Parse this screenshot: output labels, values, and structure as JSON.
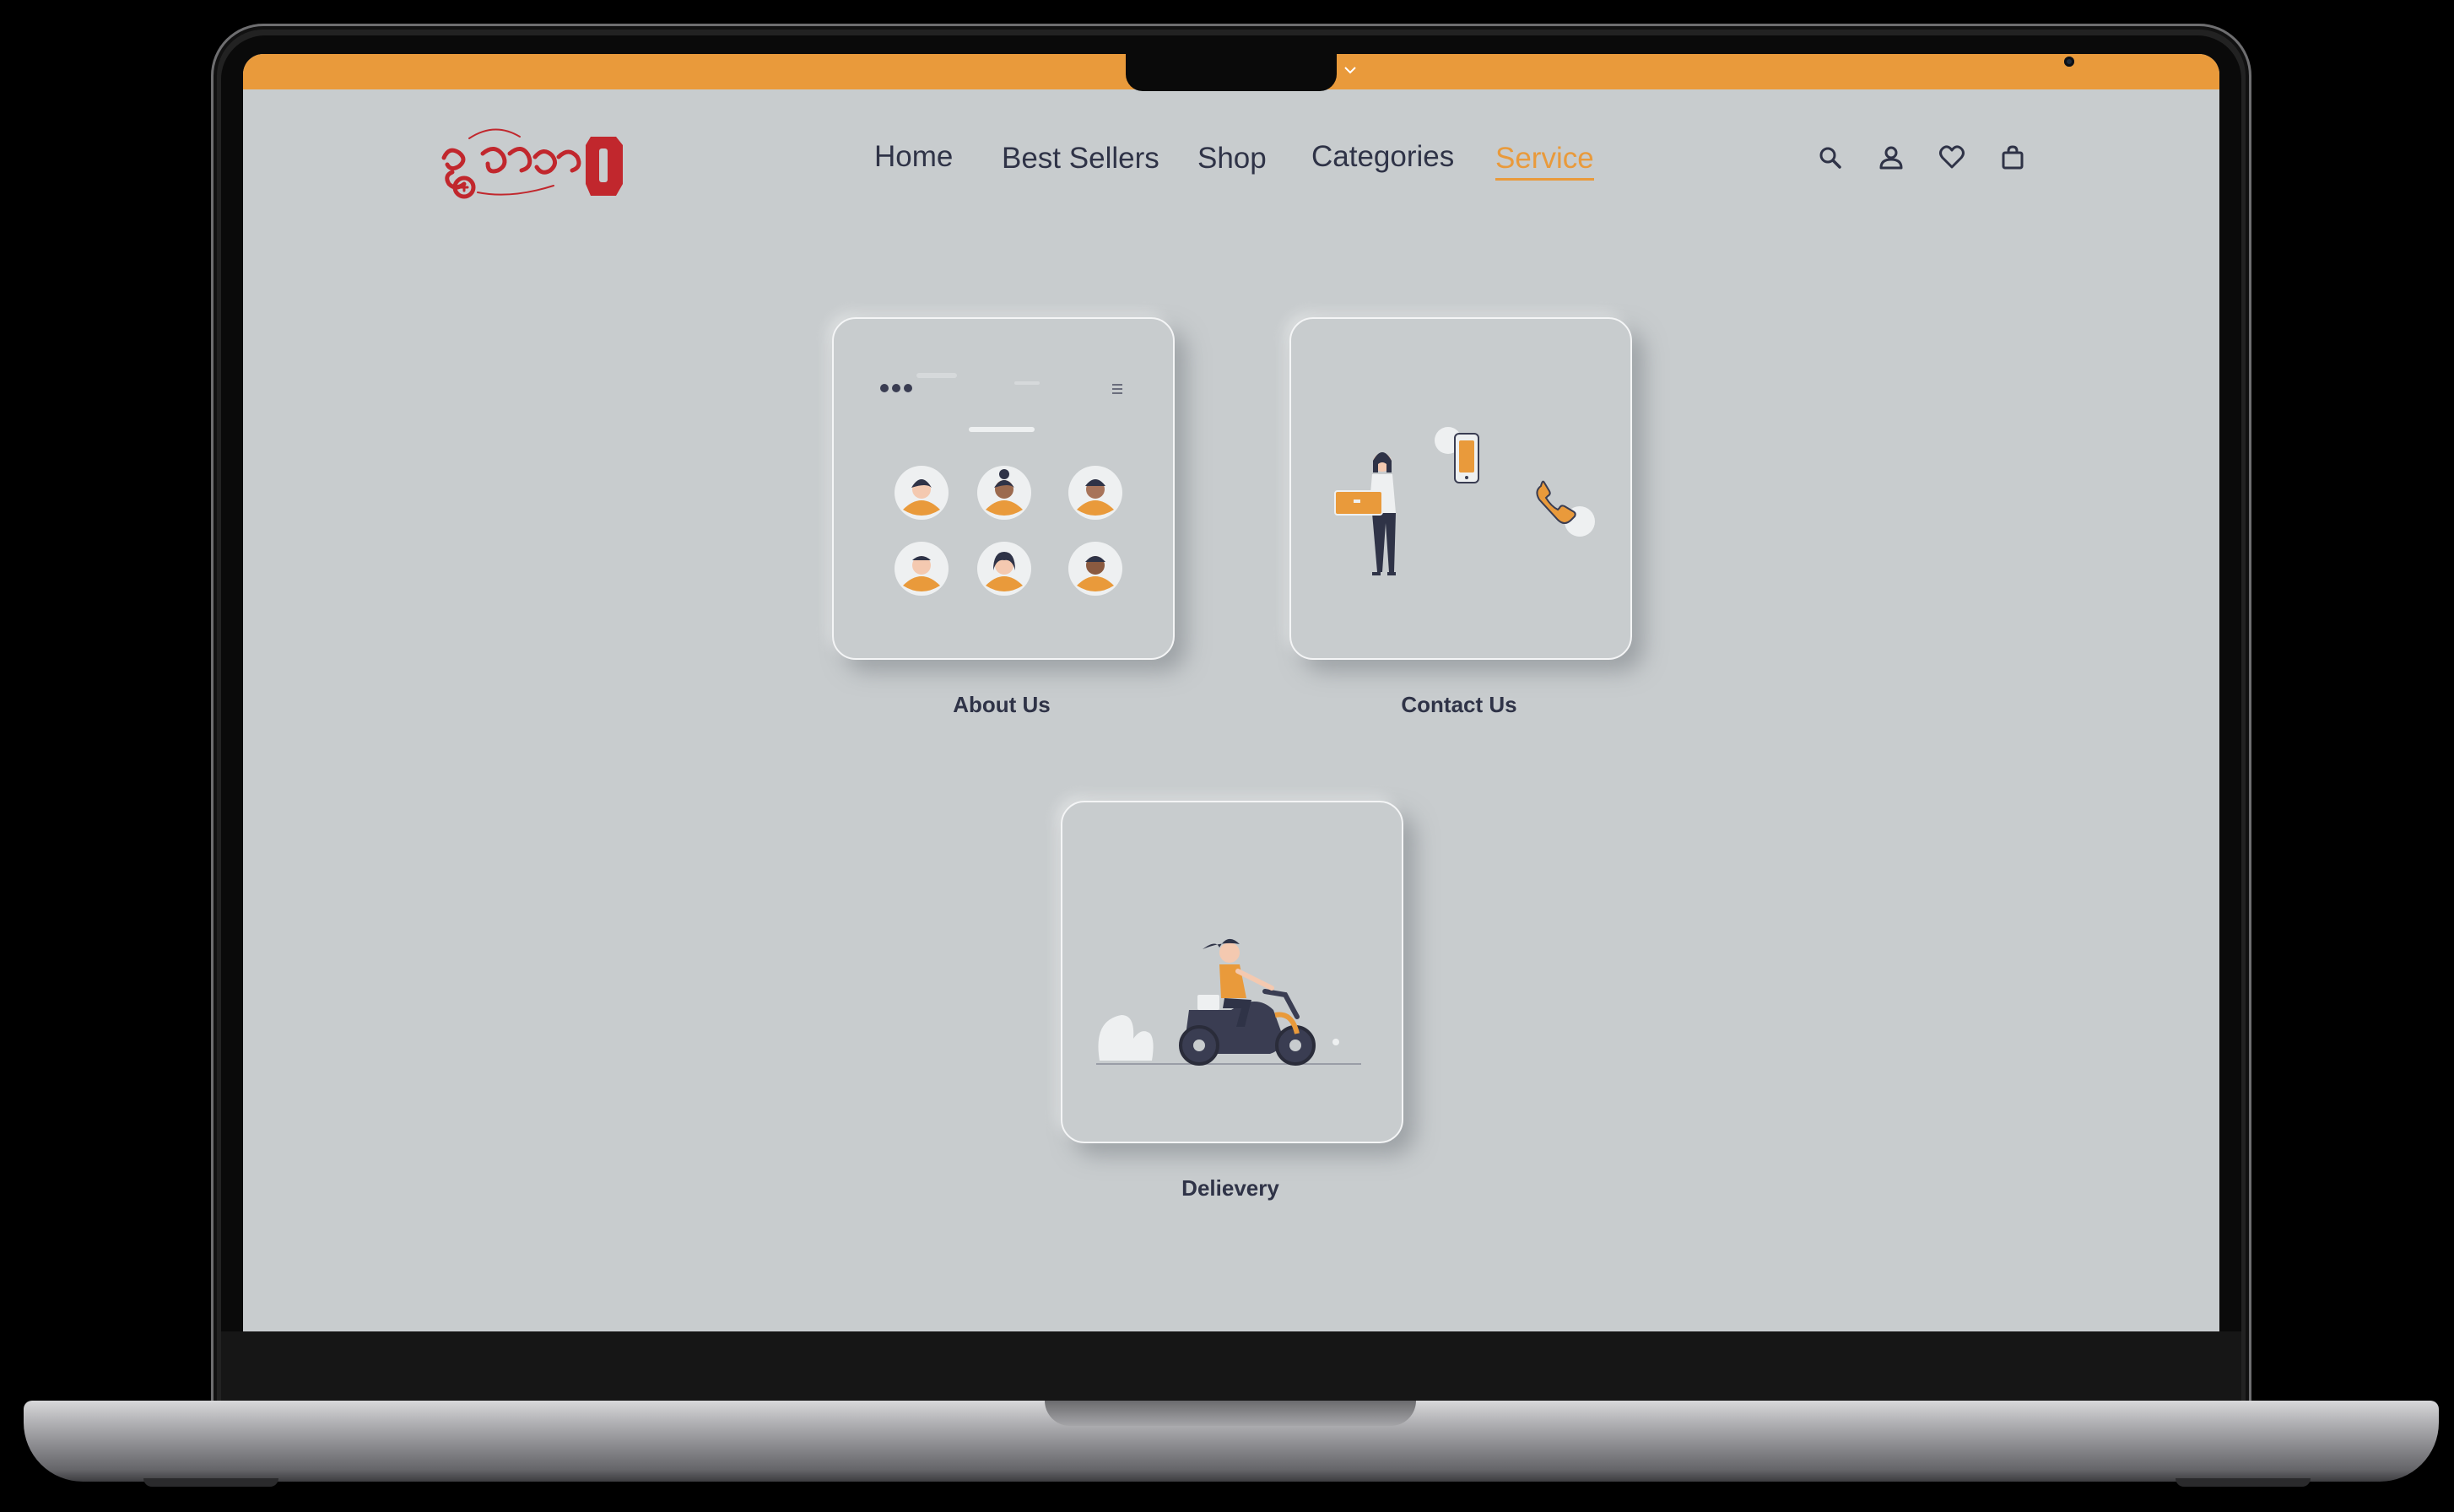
{
  "nav": {
    "home": "Home",
    "best_sellers": "Best Sellers",
    "shop": "Shop",
    "categories": "Categories",
    "service": "Service"
  },
  "header_icons": [
    "search-icon",
    "user-icon",
    "heart-icon",
    "bag-icon"
  ],
  "services": {
    "about": "About Us",
    "contact": "Contact Us",
    "delivery": "Delievery"
  },
  "colors": {
    "accent": "#e99a3b",
    "text": "#2f3347",
    "background": "#c8ccce",
    "logo": "#c1272d"
  }
}
